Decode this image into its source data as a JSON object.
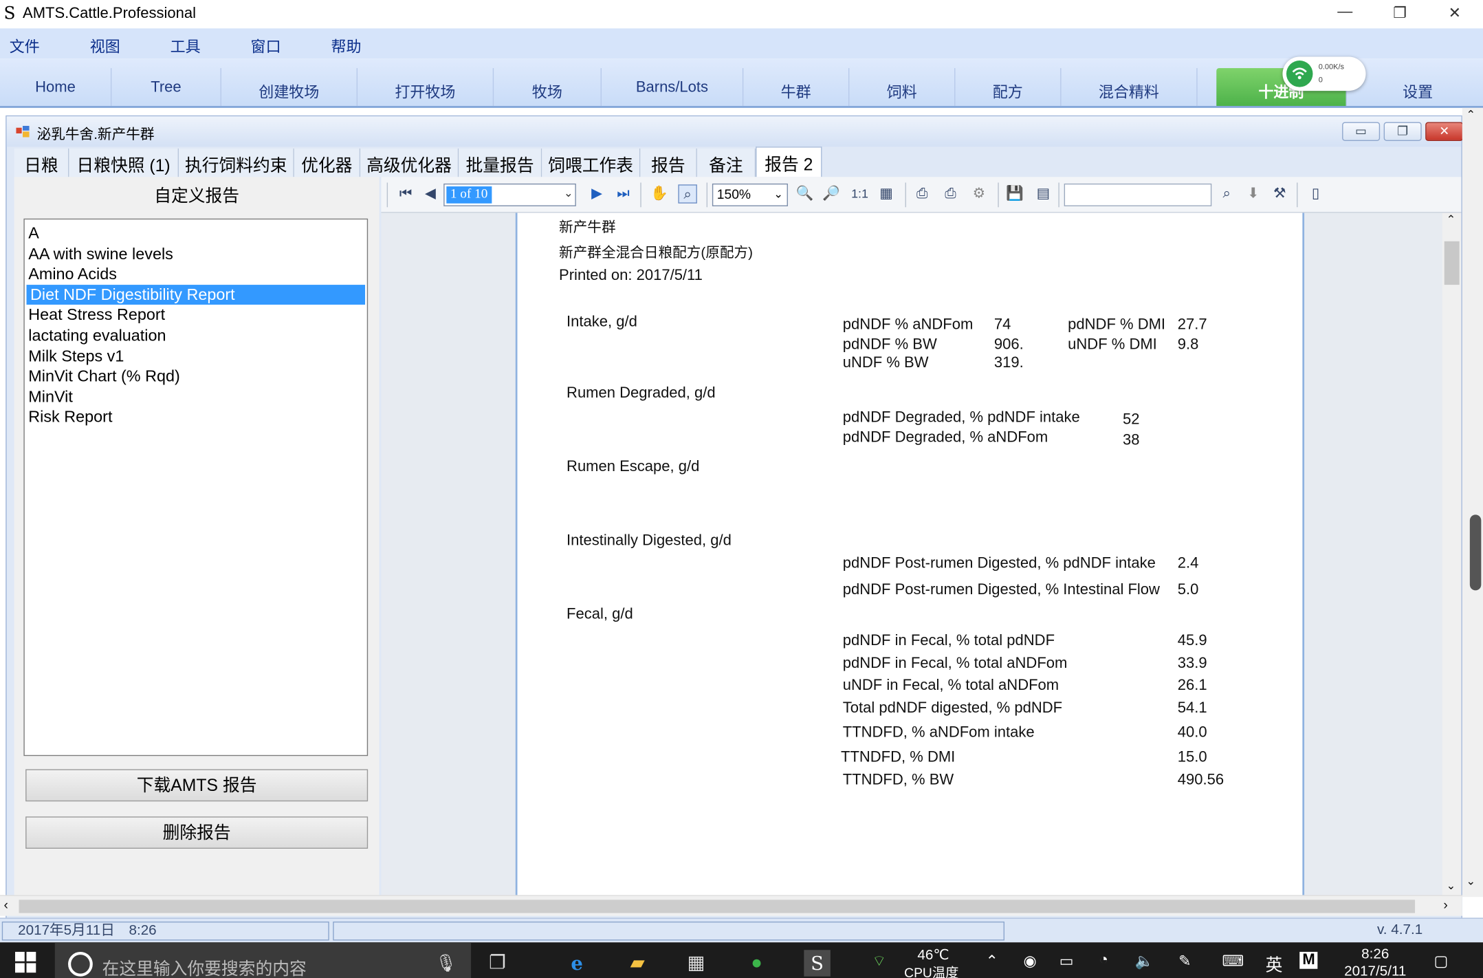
{
  "window": {
    "title": "AMTS.Cattle.Professional",
    "min": "—",
    "max": "❐",
    "close": "✕"
  },
  "menu": [
    "文件",
    "视图",
    "工具",
    "窗口",
    "帮助"
  ],
  "nav": {
    "tabs": [
      "Home",
      "Tree",
      "创建牧场",
      "打开牧场",
      "牧场",
      "Barns/Lots",
      "牛群",
      "饲料",
      "配方",
      "混合精料",
      "十进制",
      "设置"
    ],
    "active": "十进制"
  },
  "net_widget": {
    "speed": "0.00K/s",
    "connections": "0"
  },
  "child": {
    "title": "泌乳牛舍.新产牛群",
    "tabs": [
      "日粮",
      "日粮快照 (1)",
      "执行饲料约束",
      "优化器",
      "高级优化器",
      "批量报告",
      "饲喂工作表",
      "报告",
      "备注",
      "报告 2"
    ],
    "active_tab": "报告 2"
  },
  "left_panel": {
    "title": "自定义报告",
    "reports": [
      "A",
      "AA with swine levels",
      "Amino Acids",
      "Diet NDF Digestibility Report",
      "Heat Stress Report",
      "lactating evaluation",
      "Milk Steps v1",
      "MinVit Chart (% Rqd)",
      "MinVit",
      "Risk Report"
    ],
    "selected": "Diet NDF Digestibility Report",
    "download_button": "下载AMTS 报告",
    "delete_button": "删除报告"
  },
  "viewer": {
    "page_indicator": "1 of 10",
    "zoom": "150%",
    "actual_size": "1:1",
    "search_value": ""
  },
  "report": {
    "header1": "新产牛群",
    "header2": "新产群全混合日粮配方(原配方)",
    "printed": "Printed on: 2017/5/11",
    "sec_intake": "Intake, g/d",
    "intake_rows": [
      {
        "label": "pdNDF % aNDFom",
        "value": "74"
      },
      {
        "label": "pdNDF % BW",
        "value": "906."
      },
      {
        "label": "uNDF % BW",
        "value": "319."
      }
    ],
    "intake_rows_right": [
      {
        "label": "pdNDF % DMI",
        "value": "27.7"
      },
      {
        "label": "uNDF % DMI",
        "value": "9.8"
      }
    ],
    "sec_rumen_degraded": "Rumen Degraded, g/d",
    "rumen_rows": [
      {
        "label": "pdNDF Degraded, % pdNDF intake",
        "value": "52"
      },
      {
        "label": "pdNDF Degraded, % aNDFom",
        "value": "38"
      }
    ],
    "sec_rumen_escape": "Rumen Escape, g/d",
    "sec_intestinal": "Intestinally Digested, g/d",
    "intestinal_rows": [
      {
        "label": "pdNDF Post-rumen Digested, % pdNDF intake",
        "value": "2.4"
      },
      {
        "label": "pdNDF Post-rumen Digested, % Intestinal Flow",
        "value": "5.0"
      }
    ],
    "sec_fecal": "Fecal, g/d",
    "fecal_rows": [
      {
        "label": "pdNDF in Fecal, % total pdNDF",
        "value": "45.9"
      },
      {
        "label": "pdNDF in Fecal, % total aNDFom",
        "value": "33.9"
      },
      {
        "label": "uNDF in Fecal, % total aNDFom",
        "value": "26.1"
      },
      {
        "label": "Total pdNDF digested, % pdNDF",
        "value": "54.1"
      },
      {
        "label": "TTNDFD, % aNDFom intake",
        "value": "40.0"
      },
      {
        "label": "TTNDFD, % DMI",
        "value": "15.0"
      },
      {
        "label": "TTNDFD, % BW",
        "value": "490.56"
      }
    ]
  },
  "statusbar": {
    "datetime": "2017年5月11日　8:26",
    "version": "v. 4.7.1"
  },
  "taskbar": {
    "search_placeholder": "在这里输入你要搜索的内容",
    "temp": "46℃",
    "temp_label": "CPU温度",
    "ime": "英",
    "clock_time": "8:26",
    "clock_date": "2017/5/11"
  }
}
